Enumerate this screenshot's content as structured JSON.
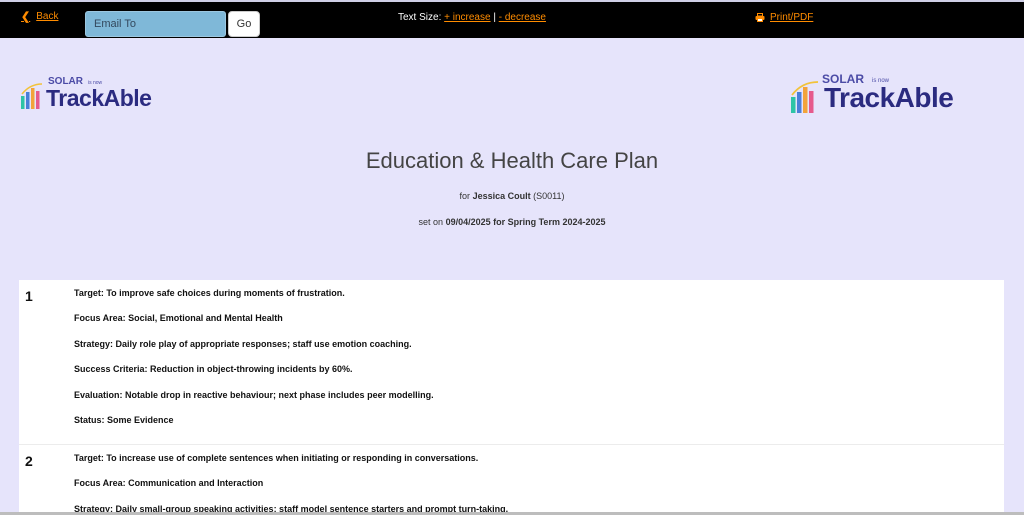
{
  "topbar": {
    "back_label": "Back",
    "email_placeholder": "Email To",
    "go_label": "Go",
    "text_size_label": "Text Size:",
    "increase_label": "+ increase",
    "separator": "|",
    "decrease_label": "- decrease",
    "print_label": "Print/PDF",
    "accent_color": "#ff8c00"
  },
  "logo": {
    "top_text": "SOLAR",
    "is_now": "is now",
    "main_text": "TrackAble"
  },
  "plan": {
    "title": "Education & Health Care Plan",
    "for_prefix": "for",
    "student_name": "Jessica Coult",
    "student_id": "(S0011)",
    "set_prefix": "set on",
    "set_info": "09/04/2025 for Spring Term 2024-2025"
  },
  "targets": [
    {
      "number": "1",
      "target": "Target: To improve safe choices during moments of frustration.",
      "focus_area": "Focus Area: Social, Emotional and Mental Health",
      "strategy": "Strategy: Daily role play of appropriate responses; staff use emotion coaching.",
      "success_criteria": "Success Criteria: Reduction in object-throwing incidents by 60%.",
      "evaluation": "Evaluation: Notable drop in reactive behaviour; next phase includes peer modelling.",
      "status": "Status: Some Evidence"
    },
    {
      "number": "2",
      "target": "Target: To increase use of complete sentences when initiating or responding in conversations.",
      "focus_area": "Focus Area: Communication and Interaction",
      "strategy": "Strategy: Daily small-group speaking activities; staff model sentence starters and prompt turn-taking."
    }
  ]
}
